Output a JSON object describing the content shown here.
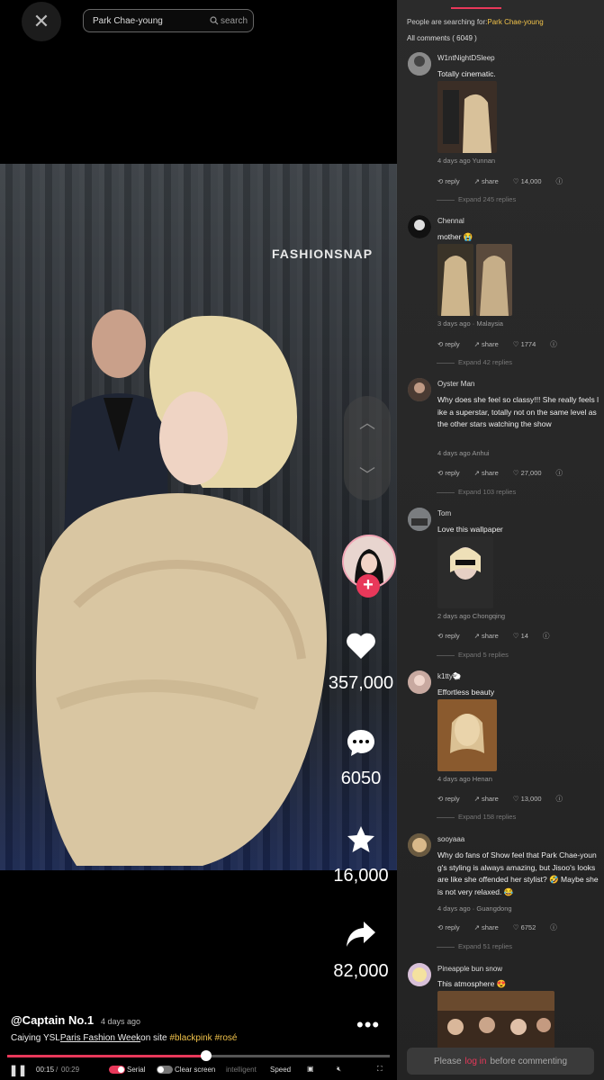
{
  "search": {
    "query": "Park Chae-young",
    "button": "search"
  },
  "video": {
    "watermark": "FASHIONSNAP"
  },
  "actions": {
    "likes": "357,000",
    "comments": "6050",
    "favorites": "16,000",
    "shares": "82,000"
  },
  "post": {
    "author": "@Captain No.1",
    "date": "4 days ago",
    "caption_prefix": "Caiying YSL",
    "caption_link": "Paris Fashion Week",
    "caption_mid": "on site",
    "tag1": "#blackpink",
    "tag2": "#rosé"
  },
  "player": {
    "progress": 0.52,
    "time_current": "00:15",
    "time_total": "00:29",
    "serial": "Serial",
    "clear_screen": "Clear screen",
    "intelligent": "intelligent",
    "speed": "Speed"
  },
  "comments_panel": {
    "searching_label": "People are searching for:",
    "searching_term": "Park Chae-young",
    "all_comments": "All comments ( 6049 )",
    "reply": "reply",
    "share": "share",
    "login_prefix": "Please",
    "login_link": "log in",
    "login_suffix": "before commenting",
    "items": [
      {
        "name": "W1ntNightDSleep",
        "text": "Totally cinematic.",
        "meta": "4 days ago Yunnan",
        "likes": "14,000",
        "expand": "Expand 245 replies"
      },
      {
        "name": "Chennal",
        "text": "mother 😭",
        "meta": "3 days ago · Malaysia",
        "likes": "1774",
        "expand": "Expand 42 replies"
      },
      {
        "name": "Oyster Man",
        "text": "Why does she feel so classy!!! She really feels like a superstar, totally not on the same level as the other stars watching the show",
        "meta": "4 days ago Anhui",
        "likes": "27,000",
        "expand": "Expand 103 replies"
      },
      {
        "name": "Tom",
        "text": "Love this wallpaper",
        "meta": "2 days ago Chongqing",
        "likes": "14",
        "expand": "Expand 5 replies"
      },
      {
        "name": "k1tty🐑",
        "text": "Effortless beauty",
        "meta": "4 days ago Henan",
        "likes": "13,000",
        "expand": "Expand 158 replies"
      },
      {
        "name": "sooyaaa",
        "text": "Why do fans of Show feel that Park Chae-young's styling is always amazing, but Jisoo's looks are like she offended her stylist? 🤣 Maybe she is not very relaxed. 😂",
        "meta": "4 days ago · Guangdong",
        "likes": "6752",
        "expand": "Expand 51 replies"
      },
      {
        "name": "Pineapple bun snow",
        "text": "This atmosphere 😍",
        "meta": "",
        "likes": "",
        "expand": ""
      }
    ]
  }
}
